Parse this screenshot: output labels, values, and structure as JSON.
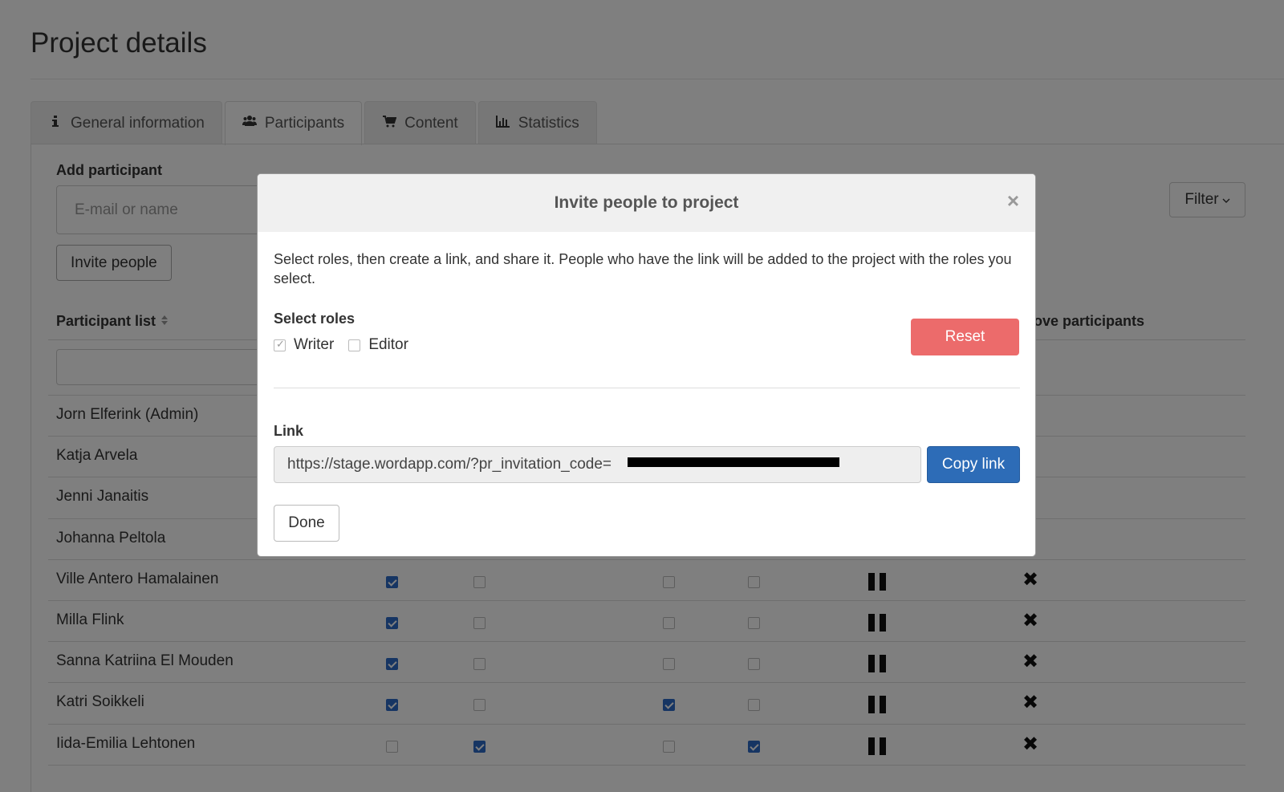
{
  "page": {
    "title": "Project details"
  },
  "tabs": [
    {
      "label": "General information",
      "icon": "info-icon",
      "active": false
    },
    {
      "label": "Participants",
      "icon": "users-icon",
      "active": true
    },
    {
      "label": "Content",
      "icon": "cart-icon",
      "active": false
    },
    {
      "label": "Statistics",
      "icon": "bar-chart-icon",
      "active": false
    }
  ],
  "add_participant": {
    "label": "Add participant",
    "placeholder": "E-mail or name",
    "invite_label": "Invite people"
  },
  "filter": {
    "label": "Filter"
  },
  "participants": {
    "header": "Participant list",
    "remove_header": "emove participants",
    "rows": [
      {
        "name": "Jorn Elferink (Admin)"
      },
      {
        "name": "Katja Arvela"
      },
      {
        "name": "Jenni Janaitis"
      },
      {
        "name": "Johanna Peltola"
      },
      {
        "name": "Ville Antero Hamalainen",
        "checks": [
          true,
          false,
          false,
          false
        ]
      },
      {
        "name": "Milla Flink",
        "checks": [
          true,
          false,
          false,
          false
        ]
      },
      {
        "name": "Sanna Katriina El Mouden",
        "checks": [
          true,
          false,
          false,
          false
        ]
      },
      {
        "name": "Katri Soikkeli",
        "checks": [
          true,
          false,
          true,
          false
        ]
      },
      {
        "name": "Iida-Emilia Lehtonen",
        "checks": [
          false,
          true,
          false,
          true
        ]
      }
    ]
  },
  "modal": {
    "title": "Invite people to project",
    "close": "×",
    "description": "Select roles, then create a link, and share it. People who have the link will be added to the project with the roles you select.",
    "roles_label": "Select roles",
    "roles": [
      {
        "label": "Writer",
        "checked": true
      },
      {
        "label": "Editor",
        "checked": false
      }
    ],
    "reset_label": "Reset",
    "link_label": "Link",
    "link_value": "https://stage.wordapp.com/?pr_invitation_code=",
    "copy_label": "Copy link",
    "done_label": "Done"
  },
  "colors": {
    "reset": "#ec6b6b",
    "primary": "#2d6cb7",
    "checkbox_on": "#2c6ac6"
  }
}
